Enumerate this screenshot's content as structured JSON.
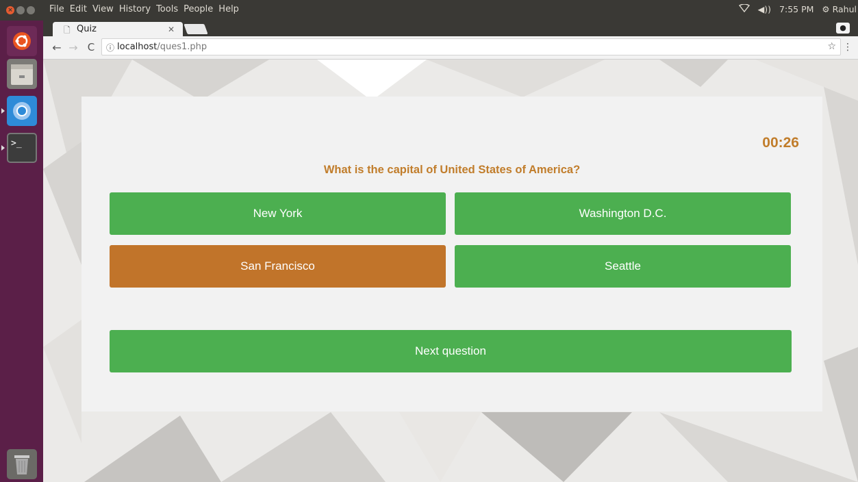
{
  "system": {
    "menus": [
      "File",
      "Edit",
      "View",
      "History",
      "Tools",
      "People",
      "Help"
    ],
    "time": "7:55 PM",
    "user": "Rahul"
  },
  "browser": {
    "tab_title": "Quiz",
    "url_host": "localhost",
    "url_path": "/ques1.php"
  },
  "quiz": {
    "timer": "00:26",
    "question": "What is the capital of United States of America?",
    "options": [
      "New York",
      "Washington D.C.",
      "San Francisco",
      "Seattle"
    ],
    "selected_option": "San Francisco",
    "next_label": "Next question"
  },
  "colors": {
    "correct_green": "#4caf50",
    "selected_orange": "#c1742a",
    "accent_text": "#c17d2b"
  }
}
